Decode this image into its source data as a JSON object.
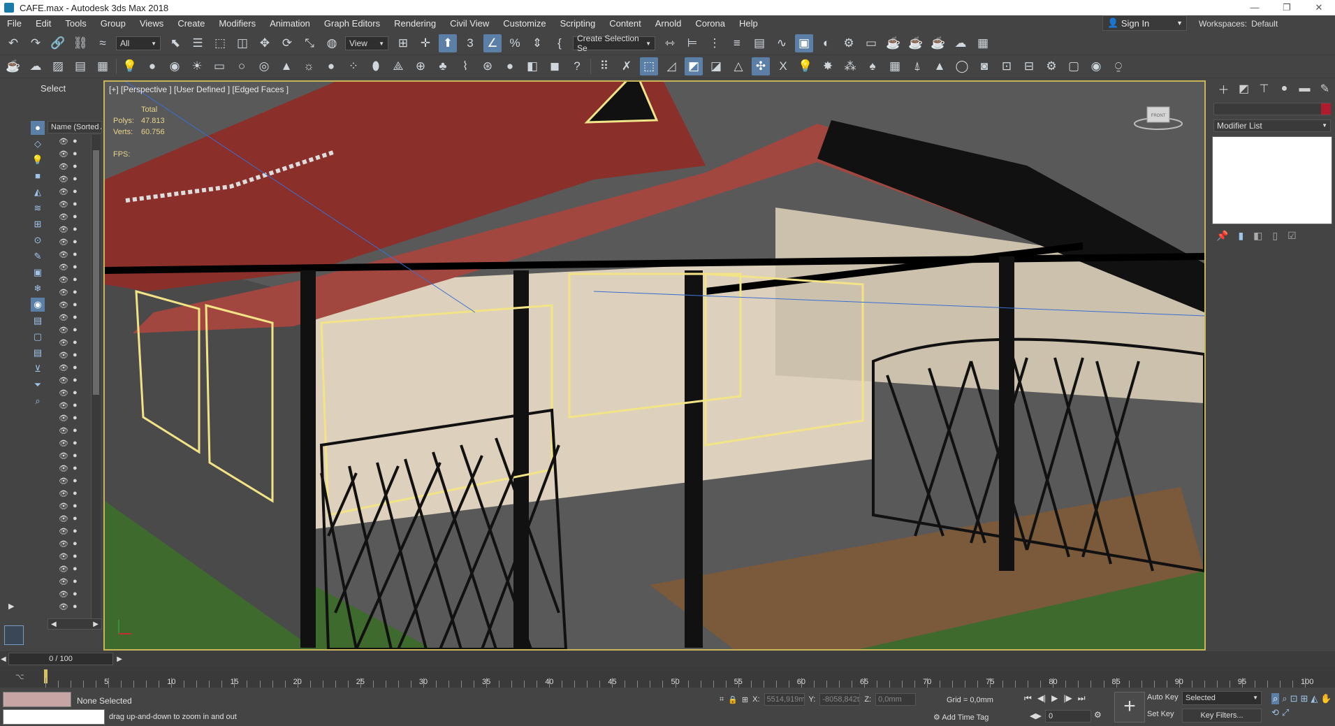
{
  "window": {
    "title": "CAFE.max - Autodesk 3ds Max 2018",
    "controls": [
      "—",
      "❐",
      "✕"
    ]
  },
  "menu": [
    "File",
    "Edit",
    "Tools",
    "Group",
    "Views",
    "Create",
    "Modifiers",
    "Animation",
    "Graph Editors",
    "Rendering",
    "Civil View",
    "Customize",
    "Scripting",
    "Content",
    "Arnold",
    "Corona",
    "Help"
  ],
  "account": {
    "sign_in": "Sign In",
    "workspaces_label": "Workspaces:",
    "workspace": "Default"
  },
  "toolbar": {
    "filter": "All",
    "coord_system": "View",
    "selection_set": "Create Selection Se"
  },
  "explorer": {
    "title": "Select",
    "column_header": "Name (Sorted A"
  },
  "viewport": {
    "label": "[+] [Perspective ] [User Defined ] [Edged Faces ]",
    "stats_title": "Total",
    "polys_label": "Polys:",
    "polys": "47.813",
    "verts_label": "Verts:",
    "verts": "60.756",
    "fps_label": "FPS:",
    "viewcube_label": "FRONT"
  },
  "command_panel": {
    "modifier_list": "Modifier List",
    "accent_color": "#b01c2e"
  },
  "timeline": {
    "slider": "0 / 100",
    "ticks": [
      0,
      5,
      10,
      15,
      20,
      25,
      30,
      35,
      40,
      45,
      50,
      55,
      60,
      65,
      70,
      75,
      80,
      85,
      90,
      95,
      100
    ]
  },
  "status": {
    "selection": "None Selected",
    "prompt": "drag up-and-down to zoom in and out",
    "x_label": "X:",
    "x": "5514,919m",
    "y_label": "Y:",
    "y": "-8058,842t",
    "z_label": "Z:",
    "z": "0,0mm",
    "grid": "Grid = 0,0mm",
    "add_time_tag": "Add Time Tag",
    "frame": "0",
    "auto_key": "Auto Key",
    "set_key": "Set Key",
    "key_mode": "Selected",
    "key_filters": "Key Filters..."
  }
}
